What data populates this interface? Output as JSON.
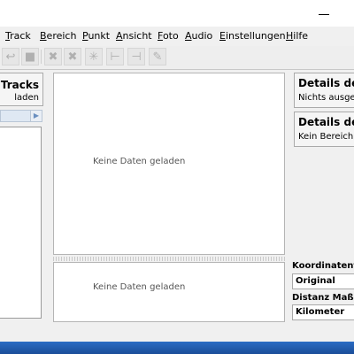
{
  "menu": {
    "items": [
      "Track",
      "Bereich",
      "Punkt",
      "Ansicht",
      "Foto",
      "Audio",
      "Einstellungen",
      "Hilfe"
    ]
  },
  "toolbar": {
    "icons": [
      "undo-icon",
      "stop-icon",
      "delete-point-icon",
      "delete-range-icon",
      "sparkle-icon",
      "range-start-icon",
      "range-end-icon",
      "edit-icon"
    ]
  },
  "left": {
    "title": "e Tracks",
    "subtitle": "laden"
  },
  "center": {
    "map_empty": "Keine Daten geladen",
    "profile_empty": "Keine Daten geladen"
  },
  "right": {
    "point_details_title": "Details des",
    "point_details_sub": "Nichts ausgew",
    "range_details_title": "Details der",
    "range_details_sub": "Kein Bereich",
    "coord_label": "Koordinatenfor",
    "coord_value": "Original",
    "distance_label": "Distanz Maßein",
    "distance_value": "Kilometer"
  }
}
